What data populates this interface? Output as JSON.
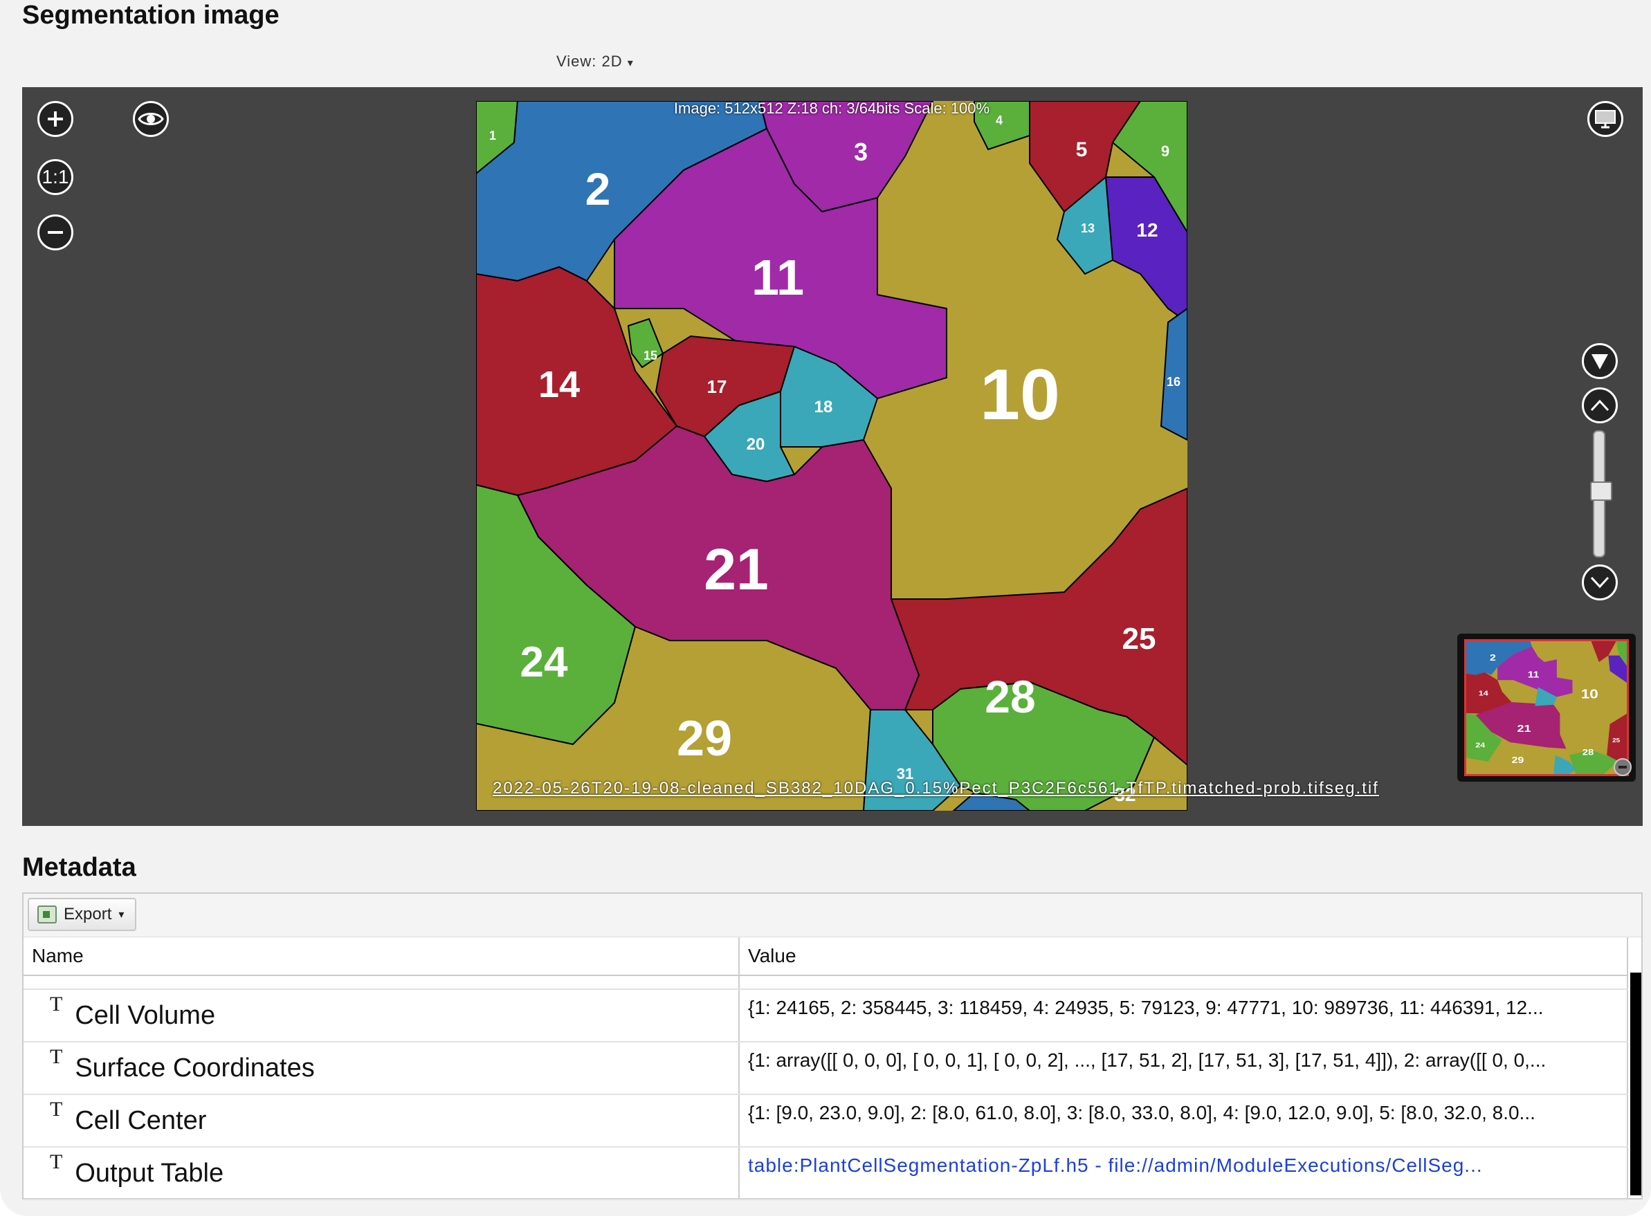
{
  "segmentation": {
    "title": "Segmentation image",
    "view_label": "View: 2D",
    "image_info": "Image: 512x512 Z:18 ch: 3/64bits Scale: 100%",
    "filename": "2022-05-26T20-19-08-cleaned_SB382_10DAG_0.15%Pect_P3C2F6c561-TfTP.timatched-prob.tifseg.tif",
    "zoom_ratio_label": "1:1",
    "cell_labels": [
      "1",
      "2",
      "3",
      "4",
      "5",
      "9",
      "10",
      "11",
      "12",
      "13",
      "14",
      "15",
      "16",
      "17",
      "18",
      "20",
      "21",
      "24",
      "25",
      "28",
      "29",
      "31",
      "32"
    ]
  },
  "metadata": {
    "title": "Metadata",
    "export_label": "Export",
    "columns": [
      "Name",
      "Value"
    ],
    "rows": [
      {
        "name": "Cell Volume",
        "value": "{1: 24165, 2: 358445, 3: 118459, 4: 24935, 5: 79123, 9: 47771, 10: 989736, 11: 446391, 12..."
      },
      {
        "name": "Surface Coordinates",
        "value": "{1: array([[ 0, 0, 0], [ 0, 0, 1], [ 0, 0, 2], ..., [17, 51, 2], [17, 51, 3], [17, 51, 4]]), 2: array([[ 0, 0,..."
      },
      {
        "name": "Cell Center",
        "value": "{1: [9.0, 23.0, 9.0], 2: [8.0, 61.0, 8.0], 3: [8.0, 33.0, 8.0], 4: [9.0, 12.0, 9.0], 5: [8.0, 32.0, 8.0..."
      },
      {
        "name": "Output Table",
        "value": "table:PlantCellSegmentation-ZpLf.h5 - file://admin/ModuleExecutions/CellSeg..."
      }
    ]
  },
  "colors": {
    "viewer_bg": "#444444",
    "link": "#1b3fe0",
    "cell_blue": "#2f74b5",
    "cell_purple": "#a02aa8",
    "cell_red": "#a81f2d",
    "cell_olive": "#b4a034",
    "cell_green": "#5ab03a",
    "cell_teal": "#3aa8b8",
    "cell_magenta": "#a62272",
    "cell_indigo": "#5a22c0"
  }
}
